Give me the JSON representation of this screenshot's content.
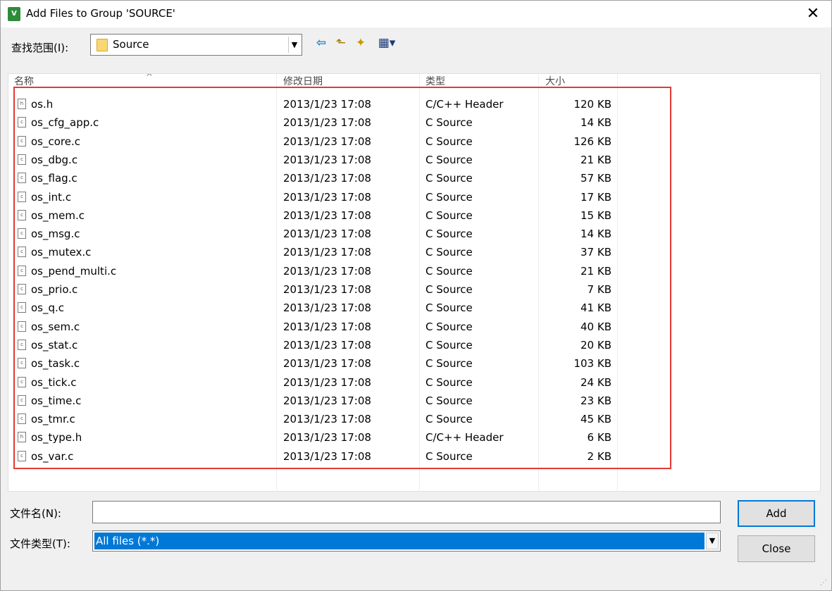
{
  "window": {
    "title": "Add Files to Group 'SOURCE'",
    "app_icon_text": "V",
    "close_glyph": "✕"
  },
  "lookin": {
    "label": "查找范围(I):",
    "value": "Source"
  },
  "toolbar": {
    "back_glyph": "⇦",
    "up_glyph": "⬑",
    "newfolder_glyph": "✦",
    "view_glyph": "▦▾"
  },
  "columns": {
    "name": "名称",
    "date": "修改日期",
    "type": "类型",
    "size": "大小"
  },
  "files": [
    {
      "name": "os.h",
      "date": "2013/1/23 17:08",
      "type": "C/C++ Header",
      "size": "120 KB",
      "icon": "h"
    },
    {
      "name": "os_cfg_app.c",
      "date": "2013/1/23 17:08",
      "type": "C Source",
      "size": "14 KB",
      "icon": "c"
    },
    {
      "name": "os_core.c",
      "date": "2013/1/23 17:08",
      "type": "C Source",
      "size": "126 KB",
      "icon": "c"
    },
    {
      "name": "os_dbg.c",
      "date": "2013/1/23 17:08",
      "type": "C Source",
      "size": "21 KB",
      "icon": "c"
    },
    {
      "name": "os_flag.c",
      "date": "2013/1/23 17:08",
      "type": "C Source",
      "size": "57 KB",
      "icon": "c"
    },
    {
      "name": "os_int.c",
      "date": "2013/1/23 17:08",
      "type": "C Source",
      "size": "17 KB",
      "icon": "c"
    },
    {
      "name": "os_mem.c",
      "date": "2013/1/23 17:08",
      "type": "C Source",
      "size": "15 KB",
      "icon": "c"
    },
    {
      "name": "os_msg.c",
      "date": "2013/1/23 17:08",
      "type": "C Source",
      "size": "14 KB",
      "icon": "c"
    },
    {
      "name": "os_mutex.c",
      "date": "2013/1/23 17:08",
      "type": "C Source",
      "size": "37 KB",
      "icon": "c"
    },
    {
      "name": "os_pend_multi.c",
      "date": "2013/1/23 17:08",
      "type": "C Source",
      "size": "21 KB",
      "icon": "c"
    },
    {
      "name": "os_prio.c",
      "date": "2013/1/23 17:08",
      "type": "C Source",
      "size": "7 KB",
      "icon": "c"
    },
    {
      "name": "os_q.c",
      "date": "2013/1/23 17:08",
      "type": "C Source",
      "size": "41 KB",
      "icon": "c"
    },
    {
      "name": "os_sem.c",
      "date": "2013/1/23 17:08",
      "type": "C Source",
      "size": "40 KB",
      "icon": "c"
    },
    {
      "name": "os_stat.c",
      "date": "2013/1/23 17:08",
      "type": "C Source",
      "size": "20 KB",
      "icon": "c"
    },
    {
      "name": "os_task.c",
      "date": "2013/1/23 17:08",
      "type": "C Source",
      "size": "103 KB",
      "icon": "c"
    },
    {
      "name": "os_tick.c",
      "date": "2013/1/23 17:08",
      "type": "C Source",
      "size": "24 KB",
      "icon": "c"
    },
    {
      "name": "os_time.c",
      "date": "2013/1/23 17:08",
      "type": "C Source",
      "size": "23 KB",
      "icon": "c"
    },
    {
      "name": "os_tmr.c",
      "date": "2013/1/23 17:08",
      "type": "C Source",
      "size": "45 KB",
      "icon": "c"
    },
    {
      "name": "os_type.h",
      "date": "2013/1/23 17:08",
      "type": "C/C++ Header",
      "size": "6 KB",
      "icon": "h"
    },
    {
      "name": "os_var.c",
      "date": "2013/1/23 17:08",
      "type": "C Source",
      "size": "2 KB",
      "icon": "c"
    }
  ],
  "filename": {
    "label": "文件名(N):",
    "value": ""
  },
  "filetype": {
    "label": "文件类型(T):",
    "value": "All files (*.*)"
  },
  "buttons": {
    "add": "Add",
    "close": "Close"
  },
  "colors": {
    "highlight_border": "#e53935",
    "selection": "#0078d7"
  }
}
